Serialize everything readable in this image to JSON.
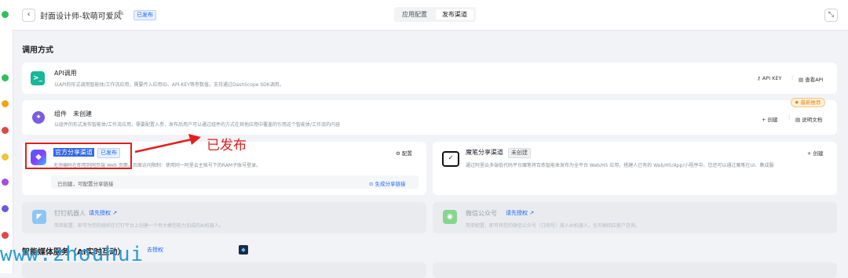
{
  "header": {
    "back_icon": "‹",
    "title": "封面设计师-软萌可爱风",
    "status": "已发布",
    "tabs": [
      "应用配置",
      "发布渠道"
    ],
    "active_tab": "发布渠道",
    "expand_icon": "⤡"
  },
  "section1": {
    "title": "调用方式"
  },
  "api": {
    "name": "API调用",
    "desc": "以API的形式调用智能体/工作流应用，需要传入应用ID、API-KEY等参数值，支持通过DashScope SDK调用。",
    "key_label": "API KEY",
    "view_label": "查看API"
  },
  "component": {
    "name": "组件",
    "status": "未创建",
    "desc": "以组件的形式发布智能体/工作流应用，需要配置入参，发布后用户可以通过组件的方式在其他应用中覆盖的引用这个智能体/工作流的内容",
    "new_badge": "最新推荐",
    "create_label": "+ 创建",
    "doc_label": "说明文档"
  },
  "official": {
    "name": "官方分享渠道",
    "status": "已发布",
    "desc": "无须编码在即用到网页端 Web 页面。页面访问限制：使用同一阿里云主账号下的RAM子账号登录。",
    "config_label": "配置",
    "foot_text": "已创建，可配置分享链接",
    "gen_link_label": "生成分享链接"
  },
  "mobi": {
    "name": "魔笔分享渠道",
    "status": "未创建",
    "desc": "通过阿里云多端低代码平台魔笔将百炼智能体发布为全平台 Web/H5 应用，搭建人已有的 Web/H5/App/小程序中。您还可以通过魔笔在UI、集成服",
    "create_label": "+ 创建"
  },
  "dingtalk": {
    "name": "钉钉机器人",
    "link": "请先授权 ↗",
    "desc": "简单配置，即可为您的组织在钉钉平台上创建一个有大模型能力加成的AI机器人。"
  },
  "wechat": {
    "name": "微信公众号",
    "link": "请先授权 ↗",
    "desc": "简单配置，即可将您的微信公众号（订阅号）接入AI机器人，全天候回应客户咨询。"
  },
  "section2": {
    "title": "智能媒体服务（AI实时互动）",
    "link": "去授权"
  },
  "annotation": {
    "text": "已发布"
  },
  "watermark": {
    "text": "www.zhouhui"
  },
  "colors": {
    "accent": "#1a66ff",
    "annotation": "#e02020",
    "watermark": "#2b9bd6"
  }
}
